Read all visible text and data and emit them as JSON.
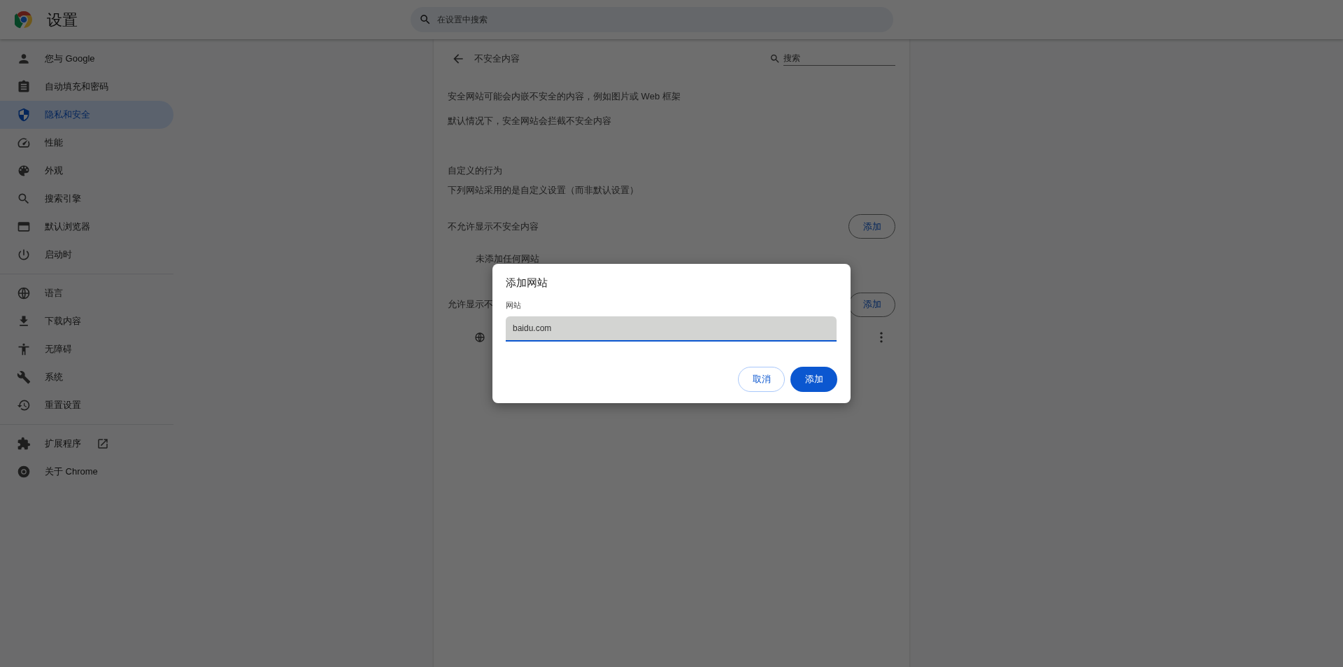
{
  "header": {
    "title": "设置",
    "search_placeholder": "在设置中搜索"
  },
  "sidebar": {
    "sections": [
      {
        "items": [
          {
            "label": "您与 Google",
            "selected": false,
            "external": false
          },
          {
            "label": "自动填充和密码",
            "selected": false,
            "external": false
          },
          {
            "label": "隐私和安全",
            "selected": true,
            "external": false
          },
          {
            "label": "性能",
            "selected": false,
            "external": false
          },
          {
            "label": "外观",
            "selected": false,
            "external": false
          },
          {
            "label": "搜索引擎",
            "selected": false,
            "external": false
          },
          {
            "label": "默认浏览器",
            "selected": false,
            "external": false
          },
          {
            "label": "启动时",
            "selected": false,
            "external": false
          }
        ]
      },
      {
        "items": [
          {
            "label": "语言",
            "selected": false,
            "external": false
          },
          {
            "label": "下载内容",
            "selected": false,
            "external": false
          },
          {
            "label": "无障碍",
            "selected": false,
            "external": false
          },
          {
            "label": "系统",
            "selected": false,
            "external": false
          },
          {
            "label": "重置设置",
            "selected": false,
            "external": false
          }
        ]
      },
      {
        "items": [
          {
            "label": "扩展程序",
            "selected": false,
            "external": true
          },
          {
            "label": "关于 Chrome",
            "selected": false,
            "external": false
          }
        ]
      }
    ]
  },
  "content": {
    "title": "不安全内容",
    "search_placeholder": "搜索",
    "description": [
      "安全网站可能会内嵌不安全的内容，例如图片或 Web 框架",
      "默认情况下，安全网站会拦截不安全内容"
    ],
    "custom_heading": "自定义的行为",
    "custom_subheading": "下列网站采用的是自定义设置（而非默认设置）",
    "lists": [
      {
        "label": "不允许显示不安全内容",
        "add_button": "添加",
        "entries": [
          {
            "kind": "empty",
            "text": "未添加任何网站"
          }
        ]
      },
      {
        "label": "允许显示不",
        "add_button": "添加",
        "entries": [
          {
            "kind": "site"
          }
        ]
      }
    ]
  },
  "dialog": {
    "title": "添加网站",
    "field_label": "网站",
    "value": "baidu.com",
    "focused": true,
    "buttons": [
      {
        "label": "取消",
        "kind": "secondary"
      },
      {
        "label": "添加",
        "kind": "primary"
      }
    ]
  }
}
